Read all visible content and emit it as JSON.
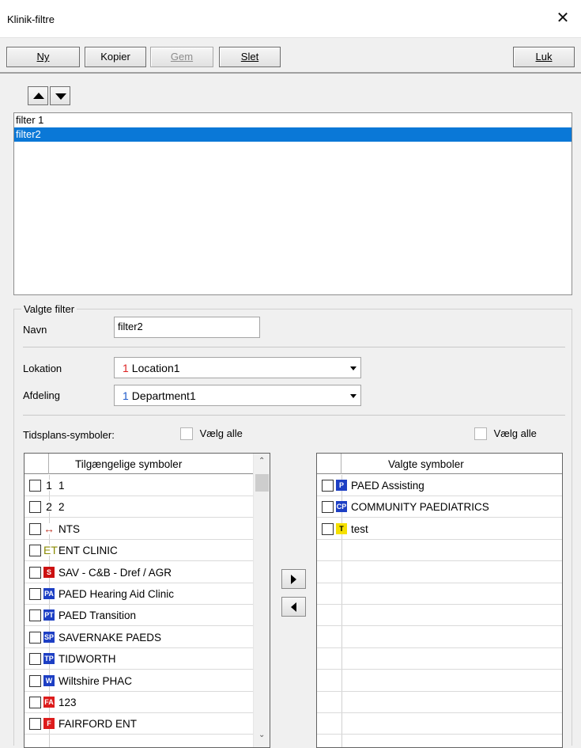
{
  "window": {
    "title": "Klinik-filtre",
    "close_glyph": "✕"
  },
  "toolbar": {
    "new_label": "Ny",
    "copy_label": "Kopier",
    "save_label": "Gem",
    "delete_label": "Slet",
    "close_label": "Luk"
  },
  "filters": {
    "items": [
      {
        "label": "filter 1",
        "selected": false
      },
      {
        "label": "filter2",
        "selected": true
      }
    ]
  },
  "selected_filter": {
    "group_label": "Valgte filter",
    "name_label": "Navn",
    "name_value": "filter2",
    "location_label": "Lokation",
    "location_value": "Location1",
    "location_icon": "1",
    "department_label": "Afdeling",
    "department_value": "Department1",
    "department_icon": "1",
    "symbols_label": "Tidsplans-symboler:",
    "select_all_left": "Vælg alle",
    "select_all_right": "Vælg alle"
  },
  "available": {
    "header": "Tilgængelige symboler",
    "rows": [
      {
        "icon": "1",
        "icon_color": "#000000",
        "icon_bg": "#ffffff",
        "text": "1"
      },
      {
        "icon": "2",
        "icon_color": "#000000",
        "icon_bg": "#ffffff",
        "text": "2"
      },
      {
        "icon": "↔",
        "icon_color": "#c0392b",
        "icon_bg": "#ffffff",
        "text": "NTS"
      },
      {
        "icon": "ET",
        "icon_color": "#8a8a00",
        "icon_bg": "#ffffff",
        "text": "ENT CLINIC"
      },
      {
        "icon": "S",
        "icon_color": "#ffffff",
        "icon_bg": "#cc1111",
        "text": "SAV - C&B - Dref / AGR"
      },
      {
        "icon": "PA",
        "icon_color": "#ffffff",
        "icon_bg": "#1d3fc4",
        "text": "PAED Hearing Aid Clinic"
      },
      {
        "icon": "PT",
        "icon_color": "#ffffff",
        "icon_bg": "#1d3fc4",
        "text": "PAED Transition"
      },
      {
        "icon": "SP",
        "icon_color": "#ffffff",
        "icon_bg": "#1d3fc4",
        "text": "SAVERNAKE PAEDS"
      },
      {
        "icon": "TP",
        "icon_color": "#ffffff",
        "icon_bg": "#1d3fc4",
        "text": "TIDWORTH"
      },
      {
        "icon": "W",
        "icon_color": "#ffffff",
        "icon_bg": "#1d3fc4",
        "text": "Wiltshire PHAC"
      },
      {
        "icon": "FA",
        "icon_color": "#ffffff",
        "icon_bg": "#dd1c1c",
        "text": "123"
      },
      {
        "icon": "F",
        "icon_color": "#ffffff",
        "icon_bg": "#dd1c1c",
        "text": "FAIRFORD ENT"
      }
    ]
  },
  "chosen": {
    "header": "Valgte symboler",
    "rows": [
      {
        "icon": "P",
        "icon_color": "#ffffff",
        "icon_bg": "#1d3fc4",
        "text": "PAED Assisting"
      },
      {
        "icon": "CP",
        "icon_color": "#ffffff",
        "icon_bg": "#1d3fc4",
        "text": "COMMUNITY PAEDIATRICS"
      },
      {
        "icon": "T",
        "icon_color": "#000000",
        "icon_bg": "#f5e000",
        "text": "test"
      }
    ]
  }
}
